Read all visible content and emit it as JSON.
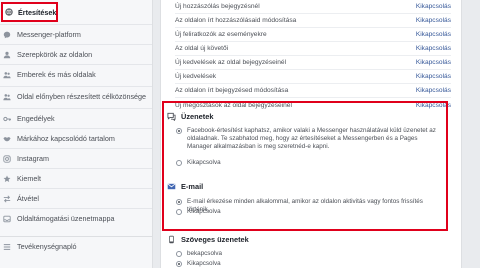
{
  "sidebar": {
    "items": [
      {
        "label": "Értesítések",
        "icon": "globe-icon"
      },
      {
        "label": "Messenger-platform",
        "icon": "messenger-icon"
      },
      {
        "label": "Szerepkörök az oldalon",
        "icon": "person-icon"
      },
      {
        "label": "Emberek és más oldalak",
        "icon": "people-icon"
      },
      {
        "label": "Oldal előnyben részesített célközönsége",
        "icon": "people-icon"
      },
      {
        "label": "Engedélyek",
        "icon": "key-icon"
      },
      {
        "label": "Márkához kapcsolódó tartalom",
        "icon": "handshake-icon"
      },
      {
        "label": "Instagram",
        "icon": "instagram-icon"
      },
      {
        "label": "Kiemelt",
        "icon": "star-icon"
      },
      {
        "label": "Átvétel",
        "icon": "transfer-icon"
      },
      {
        "label": "Oldaltámogatási üzenetmappa",
        "icon": "inbox-icon"
      },
      {
        "label": "Tevékenységnapló",
        "icon": "list-icon"
      }
    ]
  },
  "rows": [
    {
      "label": "Új hozzászólás bejegyzésnél",
      "link": "Kikapcsolás"
    },
    {
      "label": "Az oldalon írt hozzászólásaid módosítása",
      "link": "Kikapcsolás"
    },
    {
      "label": "Új feliratkozók az eseményekre",
      "link": "Kikapcsolás"
    },
    {
      "label": "Az oldal új követői",
      "link": "Kikapcsolás"
    },
    {
      "label": "Új kedvelések az oldal bejegyzéseinél",
      "link": "Kikapcsolás"
    },
    {
      "label": "Új kedvelések",
      "link": "Kikapcsolás"
    },
    {
      "label": "Az oldalon írt bejegyzésed módosítása",
      "link": "Kikapcsolás"
    },
    {
      "label": "Új megosztások az oldal bejegyzéseinél",
      "link": "Kikapcsolás"
    }
  ],
  "messages_section": {
    "title": "Üzenetek",
    "option_on": "Facebook-értesítést kaphatsz, amikor valaki a Messenger használatával küld üzenetet az oldaladnak. Te szabhatod meg, hogy az értesítéseket a Messengerben és a Pages Manager alkalmazásban is meg szeretnéd-e kapni.",
    "option_off": "Kikapcsolva"
  },
  "email_section": {
    "title": "E-mail",
    "option_on": "E-mail érkezése minden alkalommal, amikor az oldalon aktivitás vagy fontos frissítés történik.",
    "option_off": "Kikapcsolva"
  },
  "sms_section": {
    "title": "Szöveges üzenetek",
    "option_on": "bekapcsolva",
    "option_off": "Kikapcsolva"
  },
  "colors": {
    "accent": "#365899",
    "highlight": "#e0001b"
  }
}
